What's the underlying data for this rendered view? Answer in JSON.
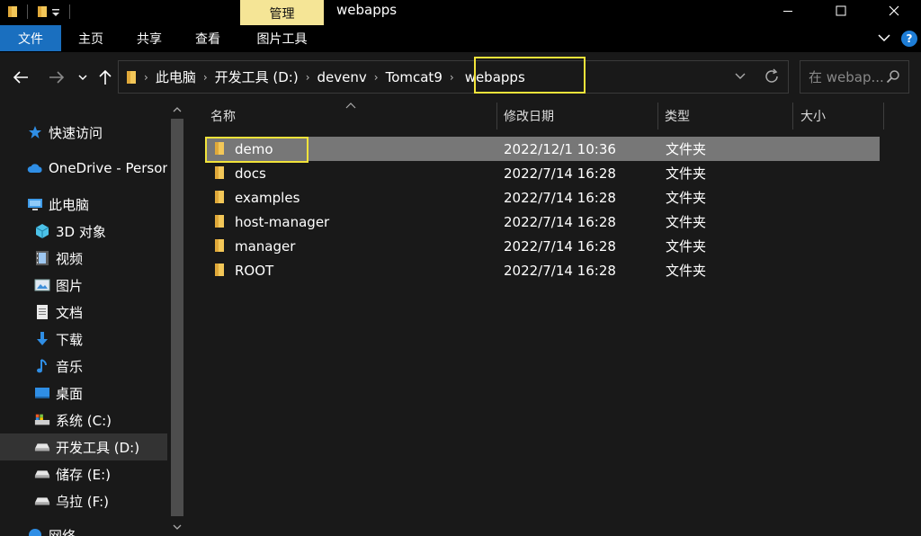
{
  "window": {
    "title": "webapps",
    "contextual_tab": "管理"
  },
  "ribbon": {
    "tabs": [
      "文件",
      "主页",
      "共享",
      "查看",
      "图片工具"
    ],
    "help": "?"
  },
  "address": {
    "crumbs": [
      "此电脑",
      "开发工具 (D:)",
      "devenv",
      "Tomcat9",
      "webapps"
    ]
  },
  "search": {
    "placeholder": "在 webap..."
  },
  "nav": {
    "quick_access": "快速访问",
    "onedrive": "OneDrive - Person",
    "this_pc": "此电脑",
    "items_3d": "3D 对象",
    "videos": "视频",
    "pictures": "图片",
    "documents": "文档",
    "downloads": "下载",
    "music": "音乐",
    "desktop": "桌面",
    "drive_c": "系统 (C:)",
    "drive_d": "开发工具 (D:)",
    "drive_e": "储存 (E:)",
    "drive_f": "乌拉 (F:)",
    "network": "网络"
  },
  "columns": {
    "name": "名称",
    "date": "修改日期",
    "type": "类型",
    "size": "大小"
  },
  "files": [
    {
      "name": "demo",
      "date": "2022/12/1 10:36",
      "type": "文件夹"
    },
    {
      "name": "docs",
      "date": "2022/7/14 16:28",
      "type": "文件夹"
    },
    {
      "name": "examples",
      "date": "2022/7/14 16:28",
      "type": "文件夹"
    },
    {
      "name": "host-manager",
      "date": "2022/7/14 16:28",
      "type": "文件夹"
    },
    {
      "name": "manager",
      "date": "2022/7/14 16:28",
      "type": "文件夹"
    },
    {
      "name": "ROOT",
      "date": "2022/7/14 16:28",
      "type": "文件夹"
    }
  ],
  "colors": {
    "highlight_box": "#f2e33a",
    "folder": "#f3c758",
    "file_tab": "#1a6fbf",
    "manage_tab": "#f5e596"
  },
  "icons": {
    "back": "arrow-left-icon",
    "forward": "arrow-right-icon",
    "recent": "chevron-down-icon",
    "up": "arrow-up-icon",
    "refresh": "refresh-icon",
    "search": "search-icon",
    "folder": "folder-icon"
  }
}
